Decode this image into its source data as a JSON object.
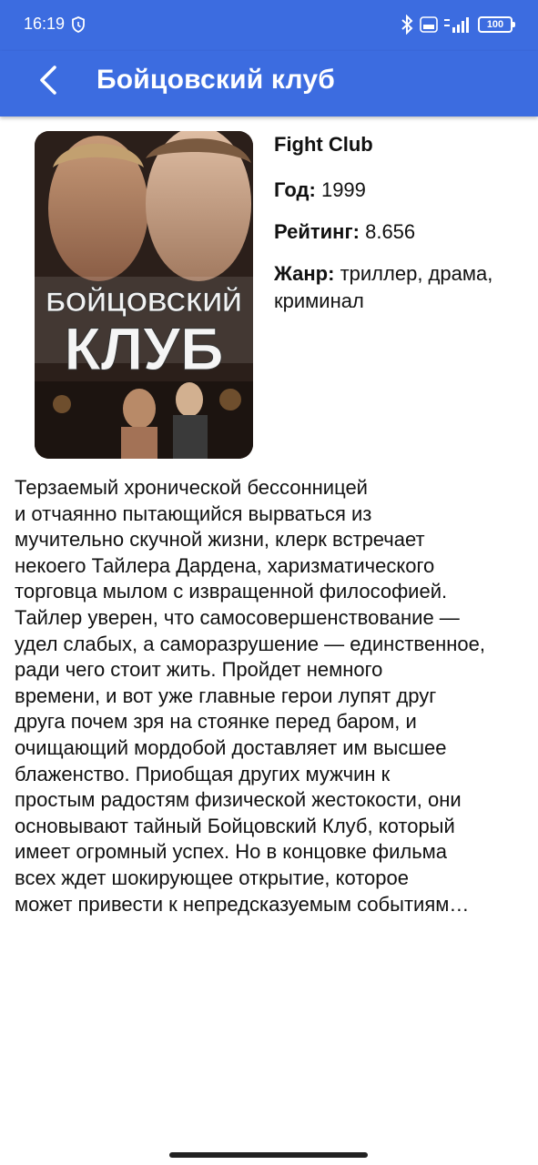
{
  "status_bar": {
    "time": "16:19",
    "battery": "100"
  },
  "app_bar": {
    "title": "Бойцовский клуб"
  },
  "poster": {
    "title_line1": "БОЙЦОВСКИЙ",
    "title_line2": "КЛУБ"
  },
  "movie": {
    "original_title": "Fight Club",
    "year_label": "Год:",
    "year": "1999",
    "rating_label": "Рейтинг:",
    "rating": "8.656",
    "genre_label": "Жанр:",
    "genre": "триллер, драма, криминал",
    "description_lines": [
      "Терзаемый хронической бессонницей",
      "и отчаянно пытающийся вырваться из",
      "мучительно скучной жизни, клерк встречает",
      "некоего Тайлера Дардена, харизматического",
      "торговца мылом с извращенной философией.",
      "Тайлер уверен, что самосовершенствование —",
      "удел слабых, а саморазрушение — единственное,",
      "ради чего стоит жить. Пройдет немного",
      "времени, и вот уже главные герои лупят друг",
      "друга почем зря на стоянке перед баром, и",
      "очищающий мордобой доставляет им высшее",
      "блаженство. Приобщая других мужчин к",
      "простым радостям физической жестокости, они",
      "основывают тайный Бойцовский Клуб, который",
      "имеет огромный успех. Но в концовке фильма",
      "всех ждет шокирующее открытие, которое",
      "может привести к непредсказуемым событиям…"
    ]
  },
  "colors": {
    "app_bar": "#3c6ce0",
    "text": "#111111",
    "background": "#ffffff"
  }
}
